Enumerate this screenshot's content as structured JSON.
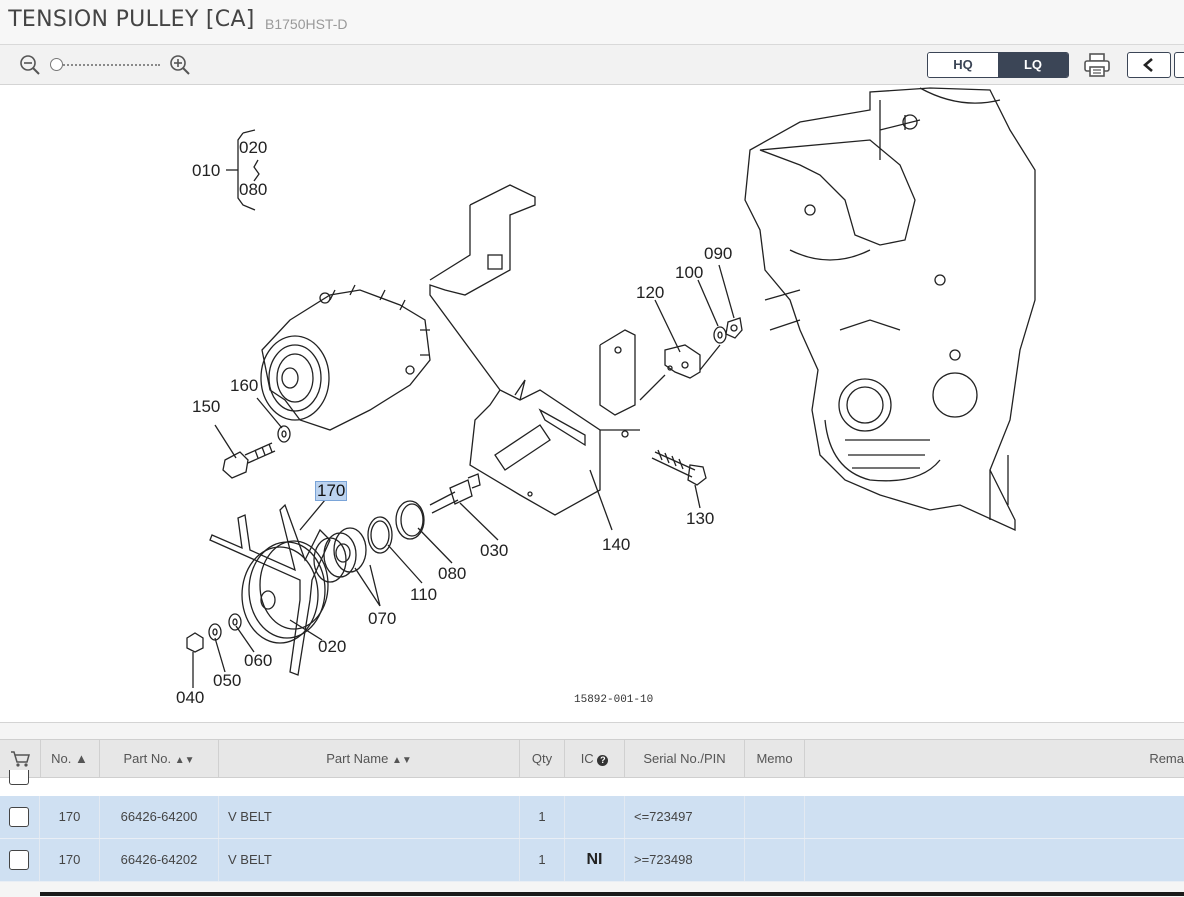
{
  "header": {
    "title": "TENSION PULLEY [CA]",
    "model": "B1750HST-D"
  },
  "toolbar": {
    "zoom_out_icon": "zoom-out-icon",
    "zoom_in_icon": "zoom-in-icon",
    "zoom_level": 0,
    "quality_options": [
      "HQ",
      "LQ"
    ],
    "quality_selected": "LQ",
    "print_icon": "printer-icon",
    "prev_icon": "chevron-left-icon"
  },
  "diagram": {
    "callouts": [
      "010",
      "020",
      "080",
      "090",
      "100",
      "120",
      "160",
      "150",
      "170",
      "030",
      "140",
      "130",
      "080",
      "110",
      "070",
      "020",
      "060",
      "050",
      "040"
    ],
    "highlighted": "170",
    "figure_id": "15892-001-10"
  },
  "table": {
    "columns": [
      "No.",
      "Part No.",
      "Part Name",
      "Qty",
      "IC",
      "Serial No./PIN",
      "Memo",
      "Rema"
    ],
    "sort_icon_no": "sort-asc-icon",
    "sort_icon_part_no": "sort-icon",
    "sort_icon_part_name": "sort-icon",
    "ic_help_icon": "help-icon",
    "cart_icon": "cart-icon",
    "rows": [
      {
        "no": "170",
        "part_no": "66426-64200",
        "part_name": "V BELT",
        "qty": "1",
        "ic": "",
        "serial": "<=723497",
        "memo": "",
        "remarks": ""
      },
      {
        "no": "170",
        "part_no": "66426-64202",
        "part_name": "V BELT",
        "qty": "1",
        "ic": "NI",
        "serial": ">=723498",
        "memo": "",
        "remarks": ""
      }
    ]
  },
  "colors": {
    "accent_dark": "#3b4556",
    "row_highlight": "#cfe0f2",
    "callout_highlight": "#bcd3ef"
  }
}
